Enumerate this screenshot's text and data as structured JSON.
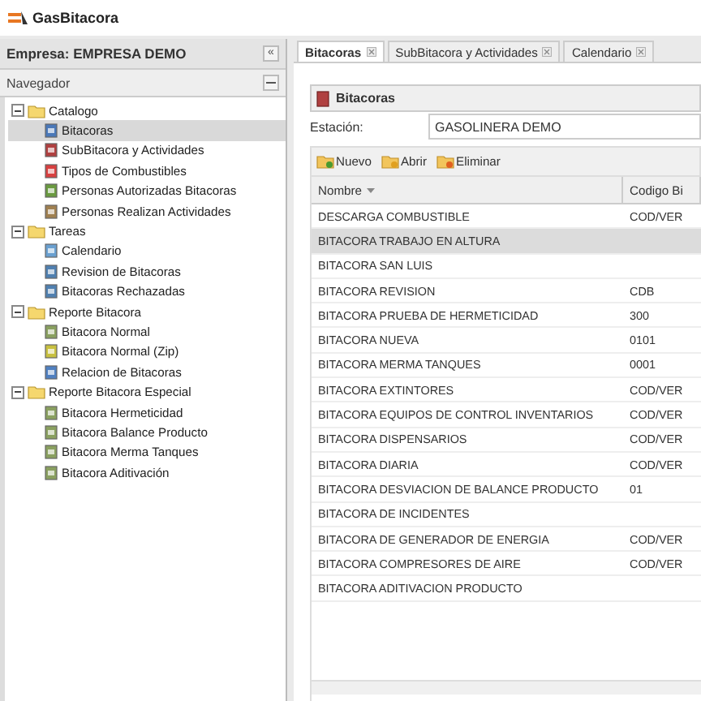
{
  "app": {
    "logo_text": "GasBitacora"
  },
  "sidebar": {
    "title": "Empresa: EMPRESA DEMO",
    "collapse_glyph": "«",
    "navigator_title": "Navegador",
    "tree": [
      {
        "label": "Catalogo",
        "expanded": true,
        "selected": false,
        "children": [
          {
            "label": "Bitacoras",
            "selected": true
          },
          {
            "label": "SubBitacora y Actividades",
            "selected": false
          },
          {
            "label": "Tipos de Combustibles",
            "selected": false
          },
          {
            "label": "Personas Autorizadas Bitacoras",
            "selected": false
          },
          {
            "label": "Personas Realizan Actividades",
            "selected": false
          }
        ]
      },
      {
        "label": "Tareas",
        "expanded": true,
        "selected": false,
        "children": [
          {
            "label": "Calendario",
            "selected": false
          },
          {
            "label": "Revision de Bitacoras",
            "selected": false
          },
          {
            "label": "Bitacoras Rechazadas",
            "selected": false
          }
        ]
      },
      {
        "label": "Reporte Bitacora",
        "expanded": true,
        "selected": false,
        "children": [
          {
            "label": "Bitacora Normal",
            "selected": false
          },
          {
            "label": "Bitacora Normal (Zip)",
            "selected": false
          },
          {
            "label": "Relacion de Bitacoras",
            "selected": false
          }
        ]
      },
      {
        "label": "Reporte Bitacora Especial",
        "expanded": true,
        "selected": false,
        "children": [
          {
            "label": "Bitacora Hermeticidad",
            "selected": false
          },
          {
            "label": "Bitacora Balance Producto",
            "selected": false
          },
          {
            "label": "Bitacora Merma Tanques",
            "selected": false
          },
          {
            "label": "Bitacora Aditivación",
            "selected": false
          }
        ]
      }
    ]
  },
  "tabs": [
    {
      "label": "Bitacoras",
      "selected": true
    },
    {
      "label": "SubBitacora y Actividades",
      "selected": false
    },
    {
      "label": "Calendario",
      "selected": false
    }
  ],
  "panel": {
    "title": "Bitacoras",
    "station_label": "Estación:",
    "station_value": "GASOLINERA DEMO",
    "toolbar": [
      "Nuevo",
      "Abrir",
      "Eliminar"
    ],
    "table": {
      "columns": [
        "Nombre",
        "Codigo Bi"
      ],
      "rows": [
        {
          "cells": [
            "DESCARGA COMBUSTIBLE",
            "COD/VER"
          ],
          "selected": false
        },
        {
          "cells": [
            "BITACORA TRABAJO EN ALTURA",
            ""
          ],
          "selected": true
        },
        {
          "cells": [
            "BITACORA SAN LUIS",
            ""
          ],
          "selected": false
        },
        {
          "cells": [
            "BITACORA REVISION",
            "CDB"
          ],
          "selected": false
        },
        {
          "cells": [
            "BITACORA PRUEBA DE HERMETICIDAD",
            "300"
          ],
          "selected": false
        },
        {
          "cells": [
            "BITACORA NUEVA",
            "0101"
          ],
          "selected": false
        },
        {
          "cells": [
            "BITACORA MERMA TANQUES",
            "0001"
          ],
          "selected": false
        },
        {
          "cells": [
            "BITACORA EXTINTORES",
            "COD/VER"
          ],
          "selected": false
        },
        {
          "cells": [
            "BITACORA EQUIPOS DE CONTROL INVENTARIOS",
            "COD/VER"
          ],
          "selected": false
        },
        {
          "cells": [
            "BITACORA DISPENSARIOS",
            "COD/VER"
          ],
          "selected": false
        },
        {
          "cells": [
            "BITACORA DIARIA",
            "COD/VER"
          ],
          "selected": false
        },
        {
          "cells": [
            "BITACORA DESVIACION DE BALANCE PRODUCTO",
            "01"
          ],
          "selected": false
        },
        {
          "cells": [
            "BITACORA DE INCIDENTES",
            ""
          ],
          "selected": false
        },
        {
          "cells": [
            "BITACORA DE GENERADOR DE ENERGIA",
            "COD/VER"
          ],
          "selected": false
        },
        {
          "cells": [
            "BITACORA COMPRESORES DE AIRE",
            "COD/VER"
          ],
          "selected": false
        },
        {
          "cells": [
            "BITACORA ADITIVACION PRODUCTO",
            ""
          ],
          "selected": false
        }
      ]
    }
  }
}
